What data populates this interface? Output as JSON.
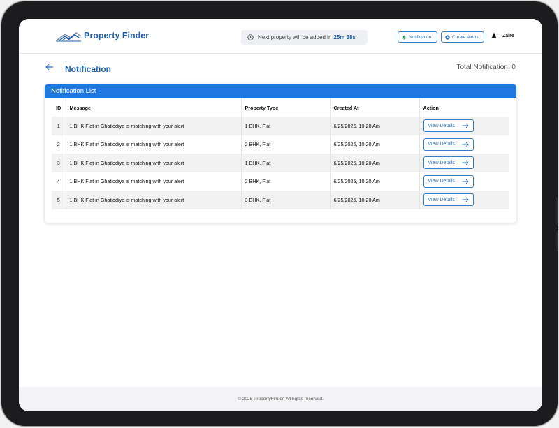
{
  "header": {
    "logo_text": "Property Finder",
    "timer_prefix": "Next property will be added in",
    "timer_value": "25m 38s",
    "notification_label": "Notification",
    "create_alerts_label": "Create Alerts",
    "user_name": "Zaire"
  },
  "page": {
    "title": "Notification",
    "total_label": "Total Notification: 0"
  },
  "card": {
    "title": "Notification List",
    "columns": [
      "ID",
      "Message",
      "Property Type",
      "Created At",
      "Action"
    ],
    "rows": [
      {
        "id": "1",
        "message": "1 BHK Flat in Ghatlodiya is matching with your alert",
        "type": "1 BHK, Flat",
        "created": "6/25/2025, 10:20 Am",
        "action": "View Details"
      },
      {
        "id": "2",
        "message": "1 BHK Flat in Ghatlodiya is matching with your alert",
        "type": "2 BHK, Flat",
        "created": "6/25/2025, 10:20 Am",
        "action": "View Details"
      },
      {
        "id": "3",
        "message": "1 BHK Flat in Ghatlodiya is matching with your alert",
        "type": "1 BHK, Flat",
        "created": "6/25/2025, 10:20 Am",
        "action": "View Details"
      },
      {
        "id": "4",
        "message": "1 BHK Flat in Ghatlodiya is matching with your alert",
        "type": "2 BHK, Flat",
        "created": "6/25/2025, 10:20 Am",
        "action": "View Details"
      },
      {
        "id": "5",
        "message": "1 BHK Flat in Ghatlodiya is matching with your alert",
        "type": "3 BHK, Flat",
        "created": "6/25/2025, 10:20 Am",
        "action": "View Details"
      }
    ]
  },
  "footer": {
    "text": "© 2025 PropertyFinder. All rights reserved."
  },
  "colors": {
    "brand": "#1d5fa8",
    "card_header": "#1e78e0",
    "button_border": "#3b7ec6"
  }
}
